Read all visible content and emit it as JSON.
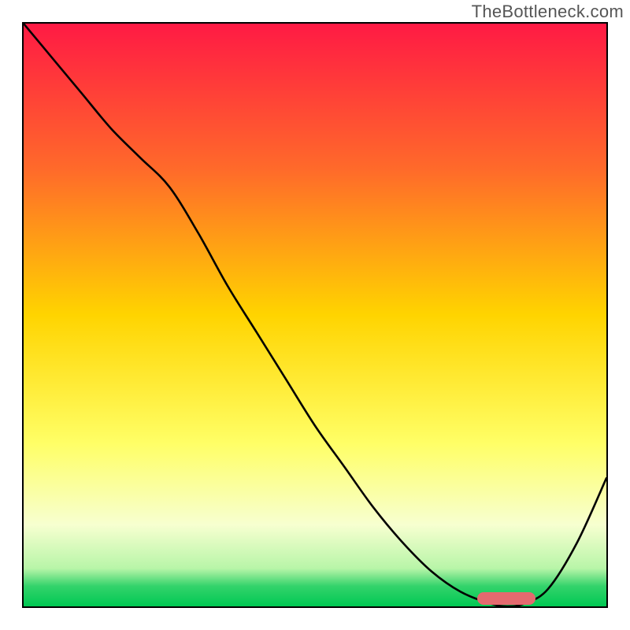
{
  "watermark": "TheBottleneck.com",
  "colors": {
    "top": "#ff1a44",
    "mid_upper": "#ff7a2a",
    "mid": "#ffd400",
    "lower_yellow": "#ffff66",
    "pale": "#f7ffd0",
    "green_top": "#6be86b",
    "green": "#00c853",
    "curve": "#000000",
    "marker": "#e46a6f",
    "border": "#000000"
  },
  "chart_data": {
    "type": "line",
    "title": "",
    "xlabel": "",
    "ylabel": "",
    "xlim": [
      0,
      100
    ],
    "ylim": [
      0,
      100
    ],
    "grid": false,
    "legend": false,
    "x": [
      0,
      5,
      10,
      15,
      20,
      25,
      30,
      35,
      40,
      45,
      50,
      55,
      60,
      65,
      70,
      75,
      80,
      83,
      86,
      90,
      95,
      100
    ],
    "values": [
      100,
      94,
      88,
      82,
      77,
      72,
      64,
      55,
      47,
      39,
      31,
      24,
      17,
      11,
      6,
      2.5,
      0.5,
      0,
      0.5,
      3,
      11,
      22
    ],
    "annotations": [
      {
        "type": "marker_bar",
        "x_start": 78,
        "x_end": 88,
        "y": 1.2
      }
    ],
    "gradient_stops": [
      {
        "pos": 0.0,
        "color": "#ff1a44"
      },
      {
        "pos": 0.25,
        "color": "#ff6a2a"
      },
      {
        "pos": 0.5,
        "color": "#ffd400"
      },
      {
        "pos": 0.72,
        "color": "#ffff66"
      },
      {
        "pos": 0.86,
        "color": "#f7ffd0"
      },
      {
        "pos": 0.935,
        "color": "#b8f5a8"
      },
      {
        "pos": 0.965,
        "color": "#34d36b"
      },
      {
        "pos": 1.0,
        "color": "#00c853"
      }
    ]
  }
}
